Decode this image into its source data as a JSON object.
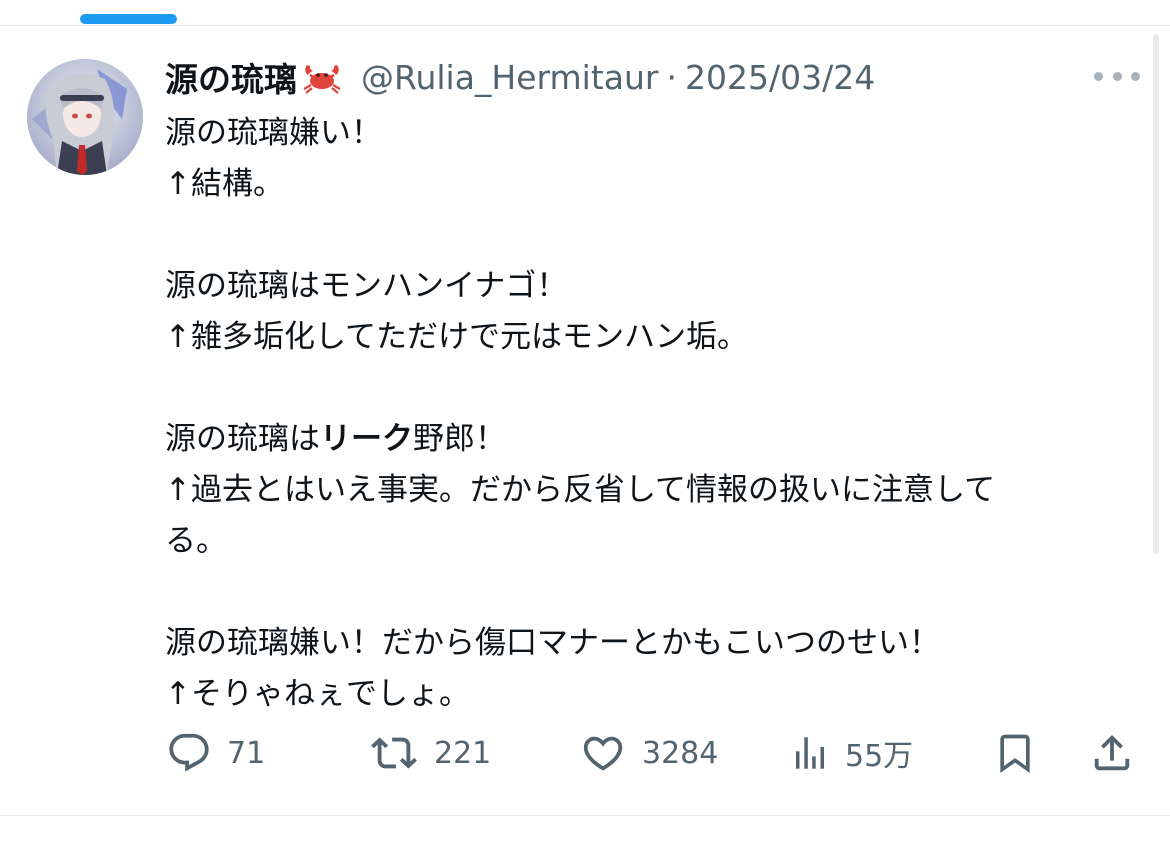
{
  "tweet": {
    "display_name": "源の琉璃",
    "name_emoji": "crab-icon",
    "handle": "@Rulia_Hermitaur",
    "separator": "·",
    "date": "2025/03/24",
    "text": {
      "p1_l1": "源の琉璃嫌い！",
      "p1_l2": "↑結構。",
      "p2_l1": "源の琉璃はモンハンイナゴ！",
      "p2_l2": "↑雑多垢化してただけで元はモンハン垢。",
      "p3_l1_pre": "源の琉璃は",
      "p3_l1_bold": "リーク",
      "p3_l1_post": "野郎！",
      "p3_l2": "↑過去とはいえ事実。だから反省して情報の扱いに注意して",
      "p3_l3": "る。",
      "p4_l1": "源の琉璃嫌い！だから傷口マナーとかもこいつのせい！",
      "p4_l2": "↑そりゃねぇでしょ。"
    }
  },
  "actions": {
    "replies": "71",
    "reposts": "221",
    "likes": "3284",
    "views": "55万"
  },
  "colors": {
    "accent": "#1d9bf0",
    "text": "#0f1419",
    "secondary": "#536471",
    "crab": "#e0433a"
  }
}
